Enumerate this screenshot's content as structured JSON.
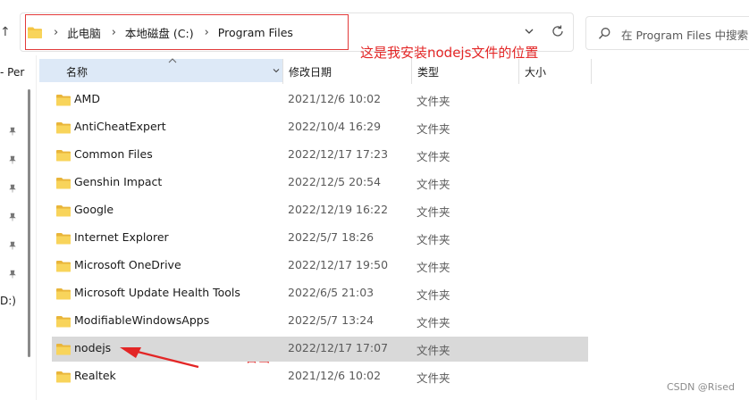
{
  "address": {
    "crumbs": [
      "此电脑",
      "本地磁盘 (C:)",
      "Program Files"
    ],
    "separator": "›"
  },
  "search": {
    "placeholder": "在 Program Files 中搜索"
  },
  "annotations": {
    "install_note": "这是我安装nodejs文件的位置",
    "right_click": "右击"
  },
  "nav": {
    "back_glyph": "↑",
    "items": [
      "- Per",
      "D:)"
    ]
  },
  "columns": {
    "name": "名称",
    "date": "修改日期",
    "type": "类型",
    "size": "大小"
  },
  "files": [
    {
      "name": "AMD",
      "date": "2021/12/6 10:02",
      "type": "文件夹"
    },
    {
      "name": "AntiCheatExpert",
      "date": "2022/10/4 16:29",
      "type": "文件夹"
    },
    {
      "name": "Common Files",
      "date": "2022/12/17 17:23",
      "type": "文件夹"
    },
    {
      "name": "Genshin Impact",
      "date": "2022/12/5 20:54",
      "type": "文件夹"
    },
    {
      "name": "Google",
      "date": "2022/12/19 16:22",
      "type": "文件夹"
    },
    {
      "name": "Internet Explorer",
      "date": "2022/5/7 18:26",
      "type": "文件夹"
    },
    {
      "name": "Microsoft OneDrive",
      "date": "2022/12/17 19:50",
      "type": "文件夹"
    },
    {
      "name": "Microsoft Update Health Tools",
      "date": "2022/6/5 21:03",
      "type": "文件夹"
    },
    {
      "name": "ModifiableWindowsApps",
      "date": "2022/5/7 13:24",
      "type": "文件夹"
    },
    {
      "name": "nodejs",
      "date": "2022/12/17 17:07",
      "type": "文件夹",
      "selected": true
    },
    {
      "name": "Realtek",
      "date": "2021/12/6 10:02",
      "type": "文件夹"
    }
  ],
  "watermark": "CSDN @Rised",
  "colors": {
    "accent_red": "#e32626",
    "folder_yellow": "#f4c542",
    "selected_row": "#d9d9d9",
    "header_highlight": "#dde9f7"
  }
}
